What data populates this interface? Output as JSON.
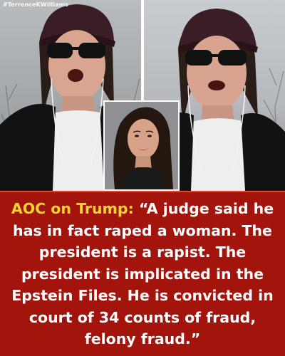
{
  "watermark": "#TerrenceKWilliams",
  "caption": {
    "lead": "AOC on Trump:",
    "quote": "“A judge said he has in fact raped a woman. The president is a rapist. The president is implicated in the Epstein Files. He is convicted in court of 34 counts of fraud, felony fraud.”"
  },
  "colors": {
    "caption_background": "#a3140c",
    "lead_text": "#f2d52e",
    "quote_text": "#ffffff"
  }
}
